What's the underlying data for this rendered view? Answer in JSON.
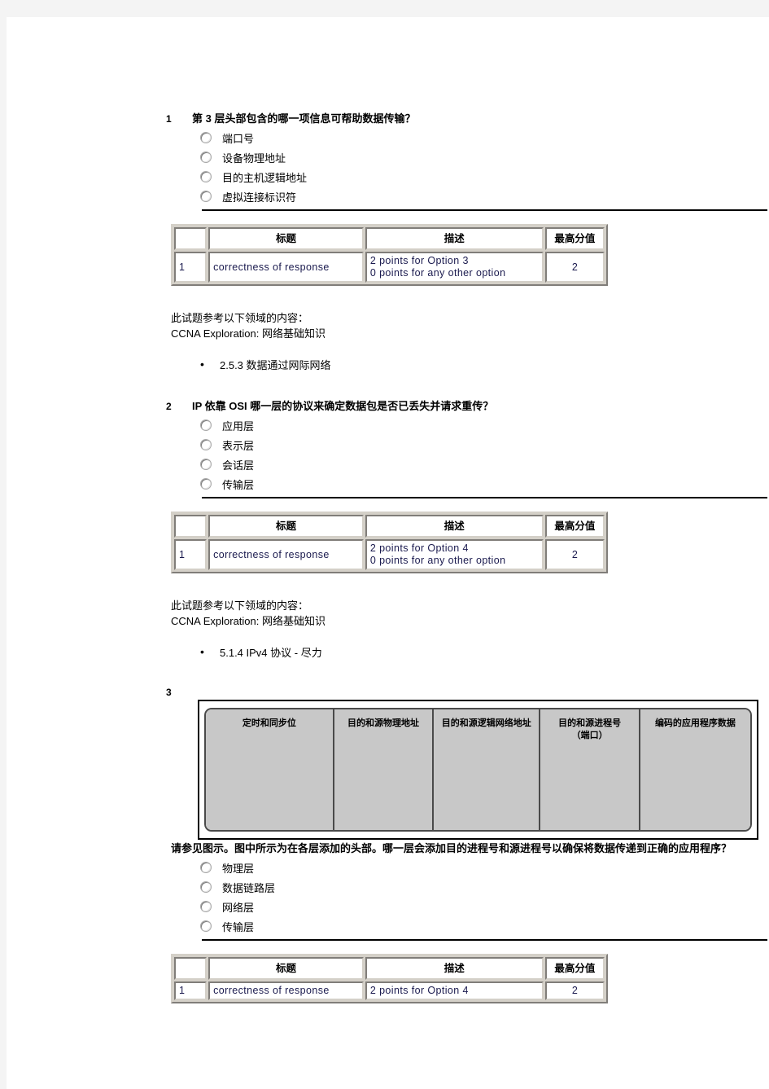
{
  "document": {
    "page_background": "#f4f4f4",
    "paper_background": "#ffffff"
  },
  "table_headers": {
    "index": "",
    "title": "标题",
    "description": "描述",
    "max_score": "最高分值"
  },
  "reference_labels": {
    "intro": "此试题参考以下领域的内容：",
    "course": "CCNA Exploration: 网络基础知识"
  },
  "questions": [
    {
      "number": "1",
      "text": "第 3 层头部包含的哪一项信息可帮助数据传输？",
      "options": [
        "端口号",
        "设备物理地址",
        "目的主机逻辑地址",
        "虚拟连接标识符"
      ],
      "scoring": {
        "row_index": "1",
        "criterion": "correctness of response",
        "description": "2 points for Option 3\n0 points for any other option",
        "max_score": "2"
      },
      "reference": {
        "intro": "此试题参考以下领域的内容：",
        "course": "CCNA Exploration: 网络基础知识",
        "topics": [
          "2.5.3 数据通过网际网络"
        ]
      }
    },
    {
      "number": "2",
      "text": "IP 依靠 OSI 哪一层的协议来确定数据包是否已丢失并请求重传？",
      "options": [
        "应用层",
        "表示层",
        "会话层",
        "传输层"
      ],
      "scoring": {
        "row_index": "1",
        "criterion": "correctness of response",
        "description": "2 points for Option 4\n0 points for any other option",
        "max_score": "2"
      },
      "reference": {
        "intro": "此试题参考以下领域的内容：",
        "course": "CCNA Exploration: 网络基础知识",
        "topics": [
          "5.1.4 IPv4 协议 - 尽力"
        ]
      }
    },
    {
      "number": "3",
      "exhibit": {
        "cells": [
          "定时和同步位",
          "目的和源物理地址",
          "目的和源逻辑网络地址",
          "目的和源进程号\n（端口）",
          "编码的应用程序数据"
        ]
      },
      "text": "请参见图示。图中所示为在各层添加的头部。哪一层会添加目的进程号和源进程号以确保将数据传递到正确的应用程序？",
      "options": [
        "物理层",
        "数据链路层",
        "网络层",
        "传输层"
      ],
      "scoring": {
        "row_index": "1",
        "criterion": "correctness of response",
        "description": "2 points for Option 4",
        "max_score": "2"
      }
    }
  ]
}
